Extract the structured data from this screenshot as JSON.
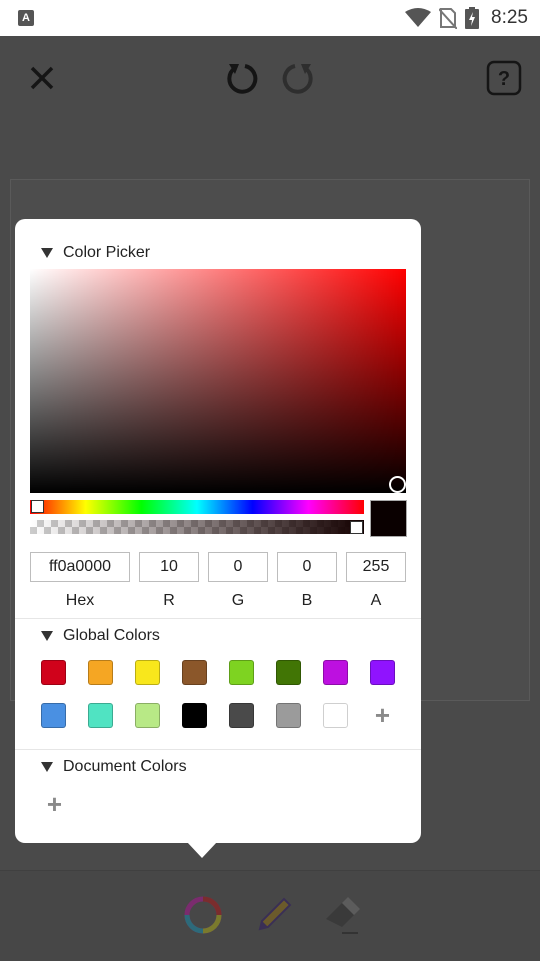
{
  "status_bar": {
    "time": "8:25",
    "icons": [
      "app-notification-icon",
      "wifi-icon",
      "no-sim-icon",
      "battery-charging-icon"
    ]
  },
  "toolbar": {
    "icons": [
      "close-icon",
      "undo-icon",
      "redo-icon",
      "help-icon"
    ]
  },
  "color_picker": {
    "title": "Color Picker",
    "hue_color": "#ff0000",
    "current_color": "#0a0000",
    "fields": {
      "hex": {
        "label": "Hex",
        "value": "ff0a0000"
      },
      "r": {
        "label": "R",
        "value": "10"
      },
      "g": {
        "label": "G",
        "value": "0"
      },
      "b": {
        "label": "B",
        "value": "0"
      },
      "a": {
        "label": "A",
        "value": "255"
      }
    }
  },
  "global_colors": {
    "title": "Global Colors",
    "row1": [
      "#d0021b",
      "#f5a623",
      "#f8e71c",
      "#8b572a",
      "#7ed321",
      "#417505",
      "#bd10e0",
      "#9013fe"
    ],
    "row2": [
      "#4a90e2",
      "#50e3c2",
      "#b8e986",
      "#000000",
      "#4a4a4a",
      "#9b9b9b",
      "#ffffff"
    ],
    "add_label": "+"
  },
  "document_colors": {
    "title": "Document Colors",
    "add_label": "+"
  },
  "bottom_tools": [
    "color-wheel-icon",
    "pencil-icon",
    "eraser-icon"
  ]
}
